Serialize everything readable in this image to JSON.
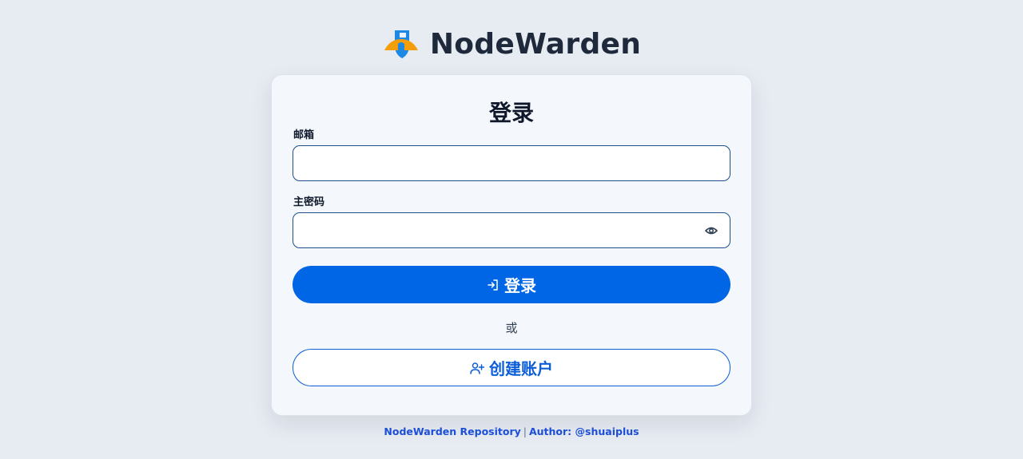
{
  "brand": {
    "name": "NodeWarden",
    "logo_icon": "shield-logo-icon",
    "logo_colors": {
      "blue": "#1e88e5",
      "orange": "#f59e0b"
    }
  },
  "login_card": {
    "title": "登录",
    "email": {
      "label": "邮箱",
      "value": "",
      "placeholder": ""
    },
    "password": {
      "label": "主密码",
      "value": "",
      "placeholder": "",
      "toggle_icon": "eye-icon"
    },
    "submit": {
      "label": "登录",
      "icon": "sign-in-icon"
    },
    "divider": "或",
    "create_account": {
      "label": "创建账户",
      "icon": "user-plus-icon"
    }
  },
  "footer": {
    "repo_link": "NodeWarden Repository",
    "separator": "|",
    "author_prefix": "Author:",
    "author_link": "@shuaiplus"
  },
  "colors": {
    "background": "#e7ecf3",
    "card": "#f4f7fb",
    "primary": "#0066e6",
    "link": "#1d4ed8"
  }
}
